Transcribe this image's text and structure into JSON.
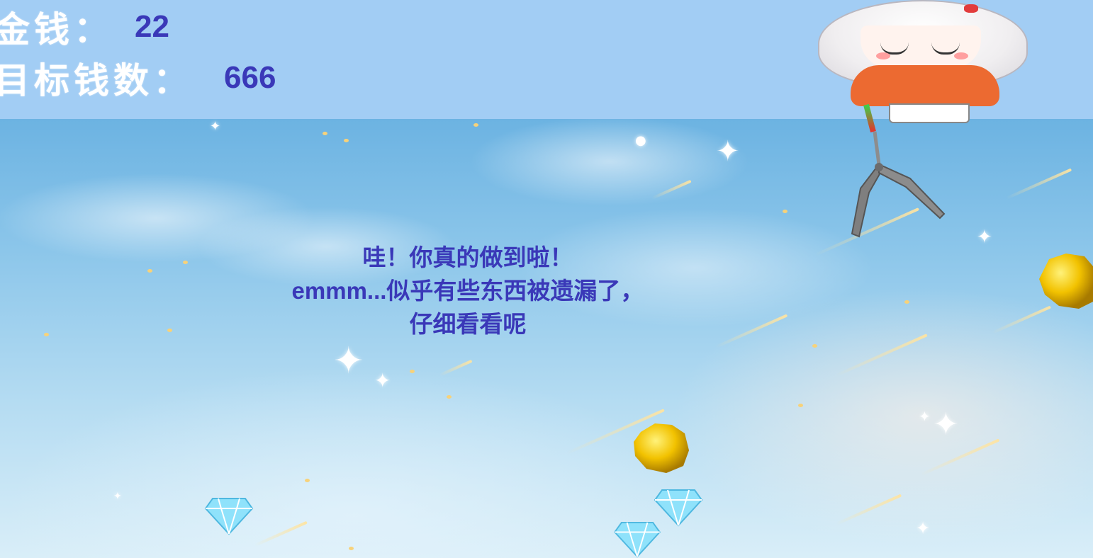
{
  "hud": {
    "money_label": "金钱：",
    "money_value": "22",
    "target_label": "目标钱数：",
    "target_value": "666"
  },
  "message": {
    "line1": "哇！你真的做到啦！",
    "line2": "emmm...似乎有些东西被遗漏了，",
    "line3": "仔细看看呢"
  },
  "colors": {
    "hud_background": "#a2cdf4",
    "value_text": "#3a38b8",
    "gold": "#f2c200",
    "diamond": "#8fe2fb"
  },
  "sprites": {
    "character": "chibi-girl-sprite",
    "claw": "claw-hook-icon",
    "gold": "gold-nugget-icon",
    "diamond": "diamond-icon"
  }
}
